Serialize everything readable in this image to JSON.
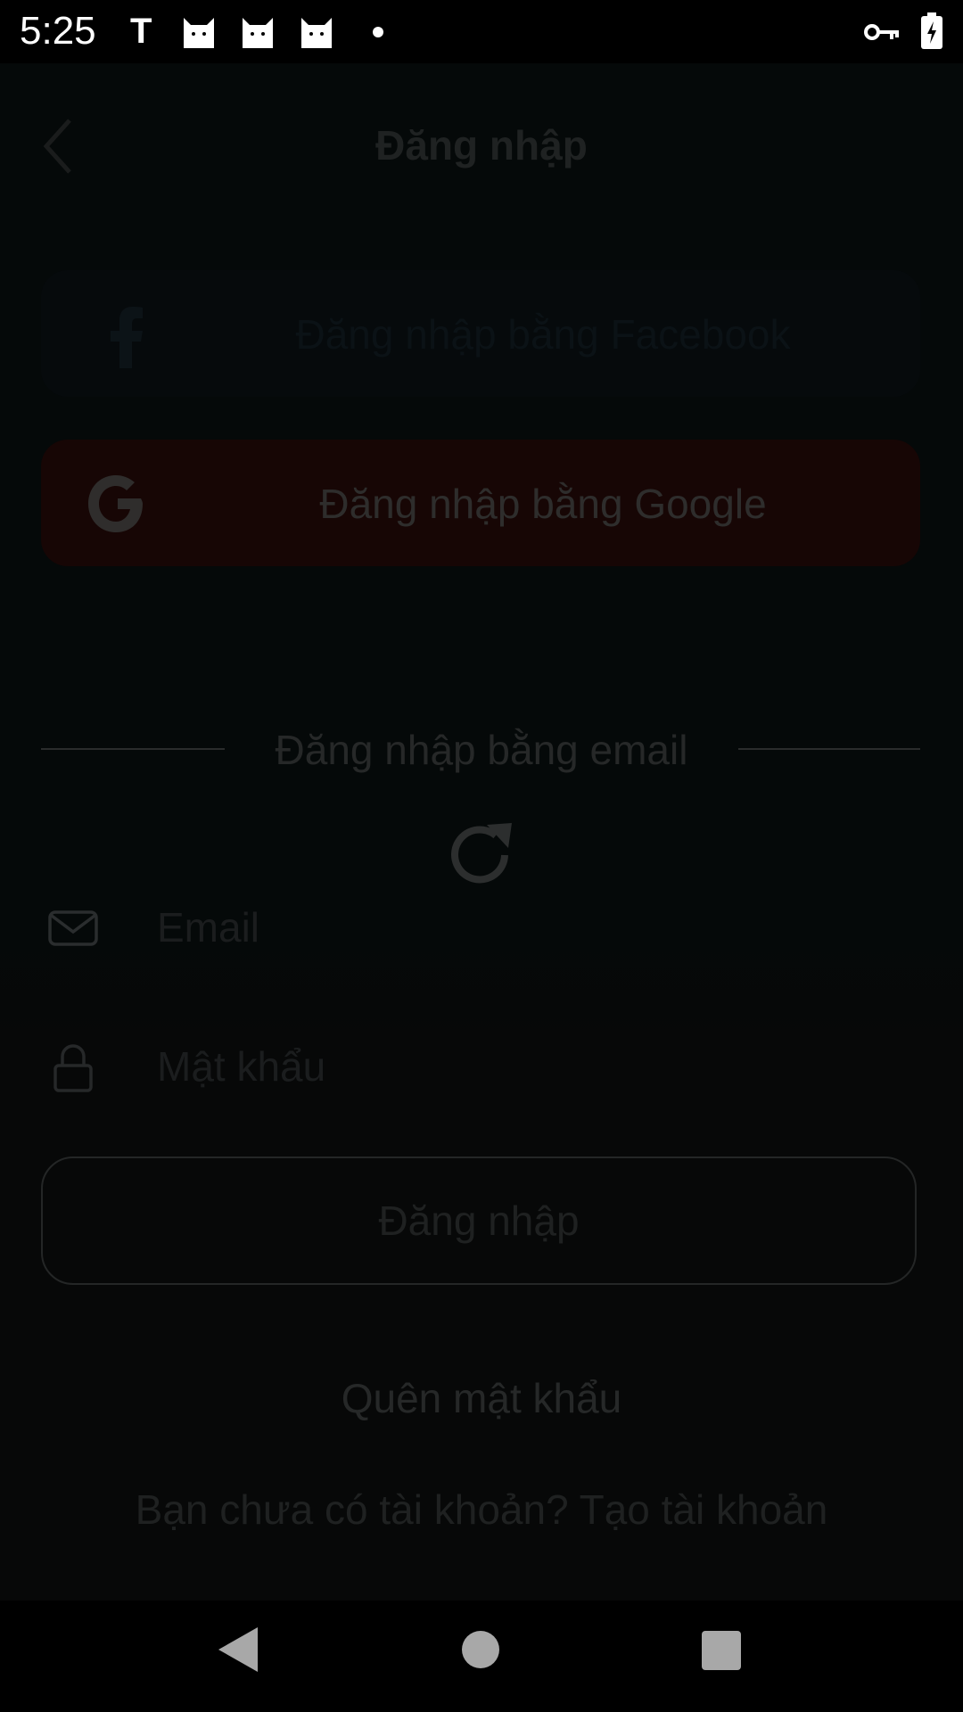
{
  "status_bar": {
    "time": "5:25",
    "notification_letter": "T",
    "icons": [
      "cat-icon",
      "cat-icon",
      "cat-icon",
      "dot-icon",
      "vpn-key-icon",
      "battery-charging-icon"
    ]
  },
  "header": {
    "title": "Đăng nhập",
    "back_icon": "chevron-left-icon"
  },
  "social_login": {
    "facebook": {
      "label": "Đăng nhập bằng Facebook",
      "icon": "facebook-icon"
    },
    "google": {
      "label": "Đăng nhập bằng Google",
      "icon": "google-icon"
    }
  },
  "email_section": {
    "divider_label": "Đăng nhập bằng email",
    "loading_icon": "refresh-icon",
    "email_placeholder": "Email",
    "password_placeholder": "Mật khẩu",
    "submit_label": "Đăng nhập"
  },
  "footer_links": {
    "forgot_password": "Quên mật khẩu",
    "register": "Bạn chưa có tài khoản? Tạo tài khoản"
  },
  "nav_bar": {
    "icons": [
      "nav-back-icon",
      "nav-home-icon",
      "nav-recents-icon"
    ]
  },
  "colors": {
    "overlay_background": "#050909",
    "google_button": "#170605",
    "facebook_button": "#060a0c",
    "dim_text": "#262828"
  }
}
